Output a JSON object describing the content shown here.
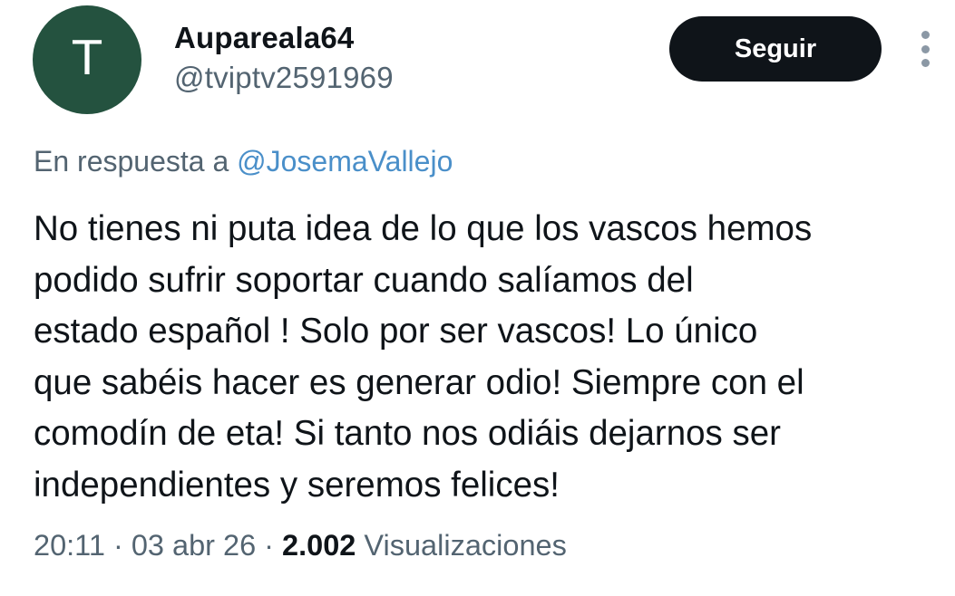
{
  "colors": {
    "avatar_bg": "#24523f",
    "button_bg": "#0f1419",
    "link": "#4a8fc9",
    "secondary_text": "#536471"
  },
  "user": {
    "avatar_letter": "T",
    "display_name": "Aupareala64",
    "handle": "@tviptv2591969"
  },
  "actions": {
    "follow_label": "Seguir",
    "more_icon": "vertical-ellipsis-icon"
  },
  "reply": {
    "prefix": "En respuesta a ",
    "to_handle": "@JosemaVallejo"
  },
  "tweet": {
    "text": "No tienes ni puta idea de lo que los vascos hemos\npodido sufrir soportar cuando salíamos del\nestado español ! Solo por ser vascos! Lo único\nque sabéis hacer es generar odio! Siempre con el\ncomodín de eta! Si tanto nos odiáis dejarnos ser\nindependientes y seremos felices!"
  },
  "meta": {
    "time": "20:11",
    "separator": " · ",
    "date": "03 abr 26",
    "views_count": "2.002",
    "views_label": " Visualizaciones"
  }
}
